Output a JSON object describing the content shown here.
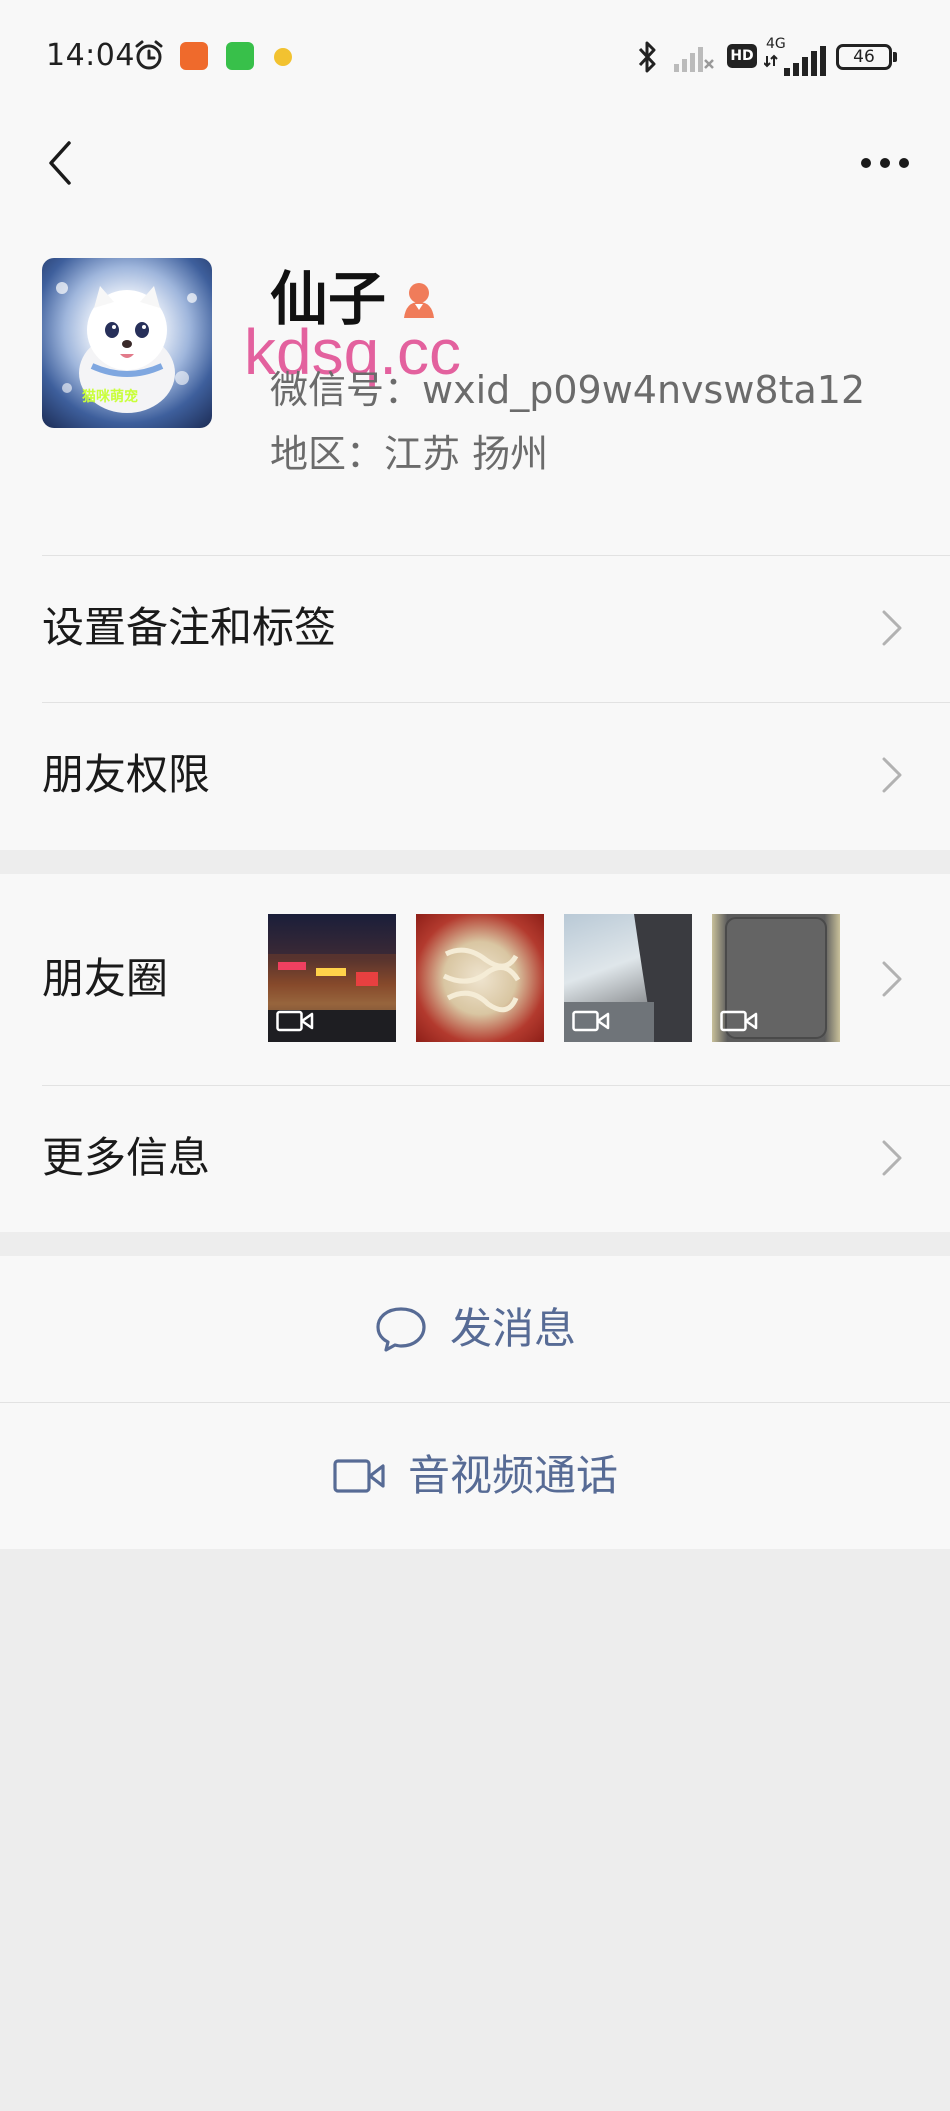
{
  "status_bar": {
    "time": "14:04",
    "network": "4G",
    "hd": "HD",
    "battery": "46"
  },
  "nav": {
    "back_icon": "chevron-left-icon",
    "more_icon": "ellipsis-icon"
  },
  "profile": {
    "nickname": "仙子",
    "gender_icon": "female-icon",
    "wechat_id": "微信号：wxid_p09w4nvsw8ta12",
    "region": "地区：江苏  扬州",
    "watermark": "kdsq.cc",
    "avatar_caption": "猫咪萌宠"
  },
  "settings": {
    "remark_label": "设置备注和标签",
    "permission_label": "朋友权限"
  },
  "moments": {
    "label": "朋友圈",
    "thumbs": [
      {
        "kind": "photo",
        "has_video": true
      },
      {
        "kind": "photo",
        "has_video": false
      },
      {
        "kind": "photo",
        "has_video": true
      },
      {
        "kind": "photo",
        "has_video": true
      }
    ]
  },
  "more_info": {
    "label": "更多信息"
  },
  "actions": {
    "message_label": "发消息",
    "call_label": "音视频通话"
  },
  "colors": {
    "link_blue": "#576b95",
    "background": "#ededed",
    "panel": "#f8f8f8"
  }
}
